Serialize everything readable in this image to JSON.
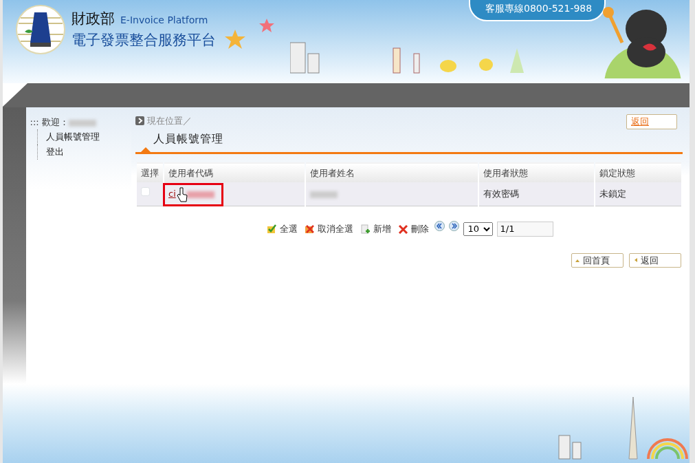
{
  "header": {
    "agency": "財政部",
    "platform_en": "E-Invoice Platform",
    "platform_zh": "電子發票整合服務平台",
    "hotline": "客服專線0800-521-988"
  },
  "sidebar": {
    "marker": ":::",
    "welcome": "歡迎：",
    "items": [
      {
        "label": "人員帳號管理"
      },
      {
        "label": "登出"
      }
    ]
  },
  "breadcrumb": "現在位置／",
  "page_title": "人員帳號管理",
  "back_top": "返回",
  "table": {
    "columns": [
      "選擇",
      "使用者代碼",
      "使用者姓名",
      "使用者狀態",
      "鎖定狀態"
    ],
    "rows": [
      {
        "checked": false,
        "code": "ci",
        "status": "有效密碼",
        "lock": "未鎖定",
        "highlighted": true
      }
    ]
  },
  "toolbar": {
    "actions": [
      {
        "kind": "select_all",
        "label": "全選"
      },
      {
        "kind": "deselect_all",
        "label": "取消全選"
      },
      {
        "kind": "add",
        "label": "新增"
      },
      {
        "kind": "delete",
        "label": "刪除"
      }
    ],
    "page_size": "10",
    "page": "1/1"
  },
  "bottom_buttons": [
    {
      "kind": "home",
      "label": "回首頁"
    },
    {
      "kind": "back",
      "label": "返回"
    }
  ]
}
